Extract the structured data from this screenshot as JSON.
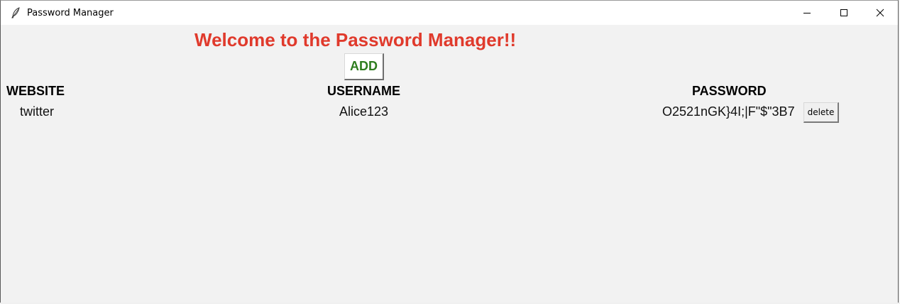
{
  "window": {
    "title": "Password Manager",
    "app_icon": "feather-icon",
    "controls": {
      "minimize_icon": "minimize-icon",
      "maximize_icon": "maximize-icon",
      "close_icon": "close-icon"
    }
  },
  "main": {
    "heading": "Welcome to the Password Manager!!",
    "add_label": "ADD",
    "columns": {
      "website": "WEBSITE",
      "username": "USERNAME",
      "password": "PASSWORD"
    },
    "rows": [
      {
        "website": "twitter",
        "username": "Alice123",
        "password": "O2521nGK}4I;|F\"$\"3B7",
        "delete_label": "delete"
      }
    ]
  },
  "colors": {
    "heading": "#e03a2c",
    "add_text": "#2e7d1e",
    "background": "#f2f2f2",
    "titlebar": "#ffffff"
  }
}
